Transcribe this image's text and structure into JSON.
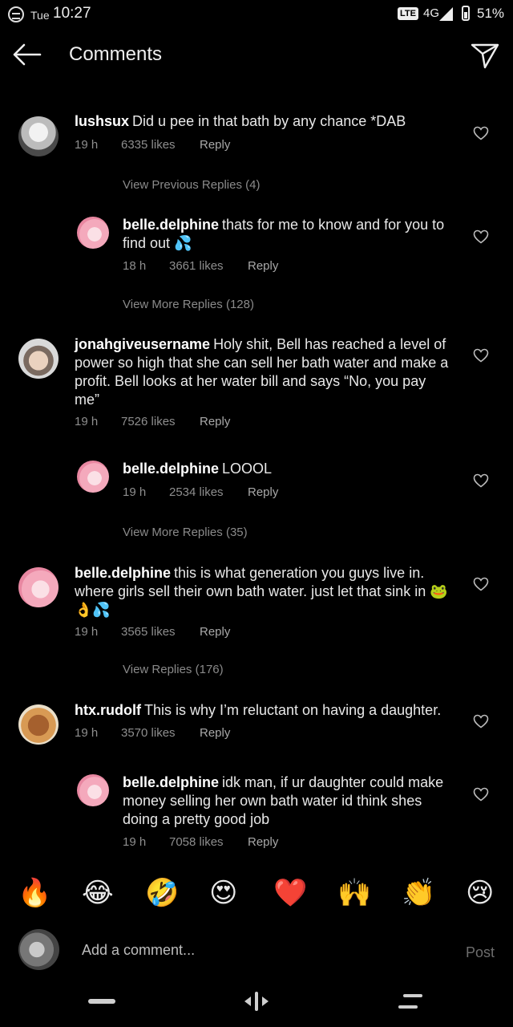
{
  "status_bar": {
    "day": "Tue",
    "time": "10:27",
    "lte": "LTE",
    "network": "4G",
    "battery": "51%"
  },
  "header": {
    "title": "Comments"
  },
  "comments": [
    {
      "username": "lushsux",
      "text": "Did u pee in that bath by any chance *DAB",
      "time": "19 h",
      "likes": "6335 likes",
      "reply": "Reply"
    },
    {
      "view_replies": "View Previous Replies (4)"
    },
    {
      "username": "belle.delphine",
      "text": "thats for me to know and for you to find out 💦",
      "time": "18 h",
      "likes": "3661 likes",
      "reply": "Reply"
    },
    {
      "view_replies": "View More Replies (128)"
    },
    {
      "username": "jonahgiveusername",
      "text": "Holy shit, Bell has reached a level of power so high that she can sell her bath water and make a profit. Bell looks at her water bill and says “No, you pay me”",
      "time": "19 h",
      "likes": "7526 likes",
      "reply": "Reply"
    },
    {
      "username": "belle.delphine",
      "text": "LOOOL",
      "time": "19 h",
      "likes": "2534 likes",
      "reply": "Reply"
    },
    {
      "view_replies": "View More Replies (35)"
    },
    {
      "username": "belle.delphine",
      "text": "this is what generation you guys live in. where girls sell their own bath water. just let that sink in 🐸👌💦",
      "time": "19 h",
      "likes": "3565 likes",
      "reply": "Reply"
    },
    {
      "view_replies": "View Replies (176)"
    },
    {
      "username": "htx.rudolf",
      "text": "This is why I’m reluctant on having a daughter.",
      "time": "19 h",
      "likes": "3570 likes",
      "reply": "Reply"
    },
    {
      "username": "belle.delphine",
      "text": "idk man, if ur daughter could make money selling her own bath water id think shes doing a pretty good job",
      "time": "19 h",
      "likes": "7058 likes",
      "reply": "Reply"
    }
  ],
  "emoji_bar": [
    "🔥",
    "😂",
    "🤣",
    "😍",
    "❤️",
    "🙌",
    "👏",
    "😢"
  ],
  "compose": {
    "placeholder": "Add a comment...",
    "post": "Post"
  },
  "icons": {
    "back": "arrow-left-icon",
    "send": "paper-plane-icon",
    "heart": "heart-outline-icon",
    "nav_home": "home-pill-icon",
    "nav_assist": "assistant-icon",
    "nav_recents": "recents-icon"
  },
  "colors": {
    "background": "#000000",
    "text": "#e8e8e8",
    "meta": "#8e8e8e",
    "post_disabled": "#6d6d6d"
  }
}
